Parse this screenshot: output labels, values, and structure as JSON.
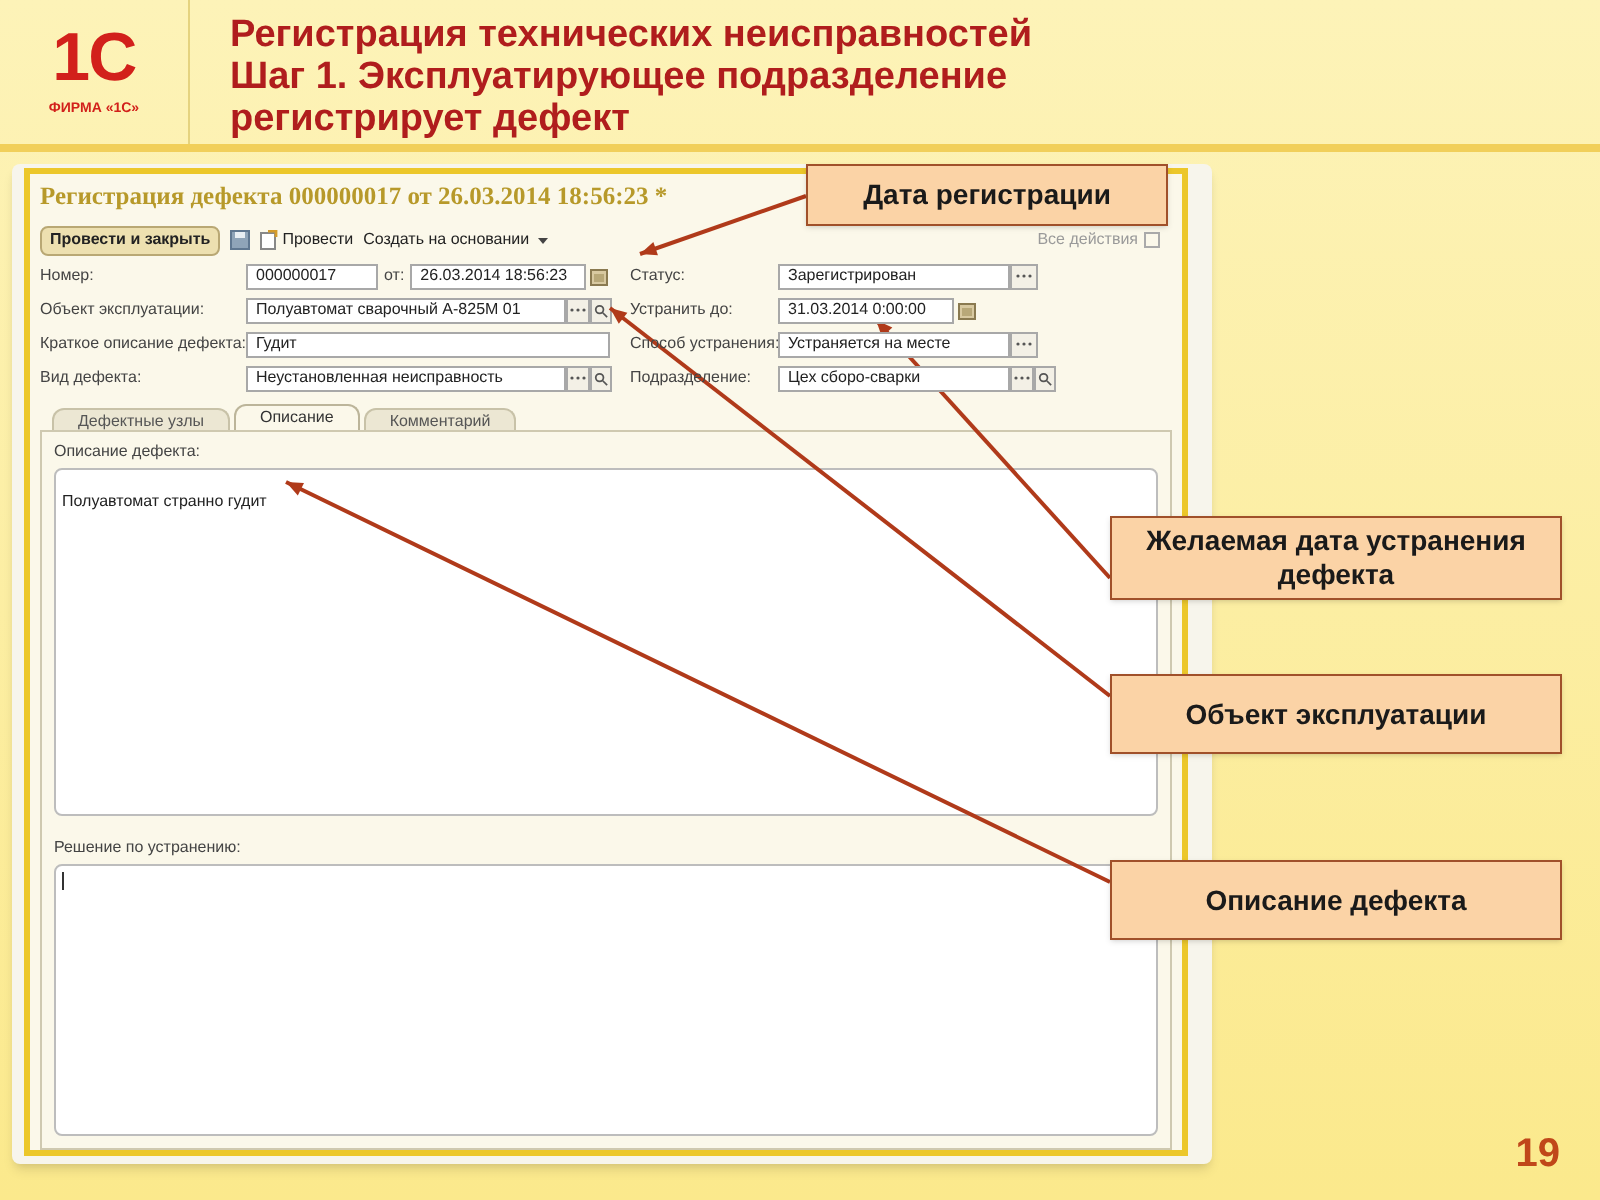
{
  "slide": {
    "logo_mark": "1С",
    "logo_caption": "ФИРМА «1С»",
    "title_lines": [
      "Регистрация технических неисправностей",
      "Шаг 1. Эксплуатирующее подразделение",
      "регистрирует дефект"
    ],
    "page_number": "19"
  },
  "form": {
    "title": "Регистрация дефекта 000000017 от 26.03.2014 18:56:23 *",
    "toolbar": [
      {
        "kind": "primary",
        "label": "Провести и закрыть"
      },
      {
        "kind": "save"
      },
      {
        "kind": "post",
        "label": "Провести"
      },
      {
        "kind": "menu",
        "label": "Создать на основании"
      }
    ],
    "all_actions": "Все действия",
    "rows": [
      {
        "label": "Номер:",
        "fields": [
          {
            "kind": "plain",
            "value": "000000017"
          },
          {
            "kind": "date",
            "prefix": "от:",
            "value": "26.03.2014 18:56:23"
          }
        ],
        "label2": "Статус:",
        "field2": {
          "kind": "choice",
          "value": "Зарегистрирован"
        }
      },
      {
        "label": "Объект эксплуатации:",
        "fields": [
          {
            "kind": "choice-search",
            "value": "Полуавтомат сварочный А-825М  01"
          }
        ],
        "label2": "Устранить до:",
        "field2": {
          "kind": "date",
          "value": "31.03.2014  0:00:00"
        }
      },
      {
        "label": "Краткое описание дефекта:",
        "fields": [
          {
            "kind": "plain",
            "value": "Гудит"
          }
        ],
        "label2": "Способ устранения:",
        "field2": {
          "kind": "choice",
          "value": "Устраняется на месте"
        }
      },
      {
        "label": "Вид дефекта:",
        "fields": [
          {
            "kind": "choice-search",
            "value": "Неустановленная неисправность"
          }
        ],
        "label2": "Подразделение:",
        "field2": {
          "kind": "choice-search",
          "value": "Цех сборо-сварки"
        }
      }
    ],
    "tabs": [
      {
        "label": "Дефектные узлы",
        "selected": false
      },
      {
        "label": "Описание",
        "selected": true
      },
      {
        "label": "Комментарий",
        "selected": false
      }
    ],
    "description_label": "Описание дефекта:",
    "description_value": "Полуавтомат странно гудит",
    "solution_label": "Решение по устранению:"
  },
  "callouts": [
    {
      "kind": "top",
      "text": "Дата регистрации"
    },
    {
      "kind": "side",
      "text": "Желаемая дата устранения дефекта"
    },
    {
      "kind": "side",
      "text": "Объект эксплуатации"
    },
    {
      "kind": "side",
      "text": "Описание дефекта"
    }
  ]
}
